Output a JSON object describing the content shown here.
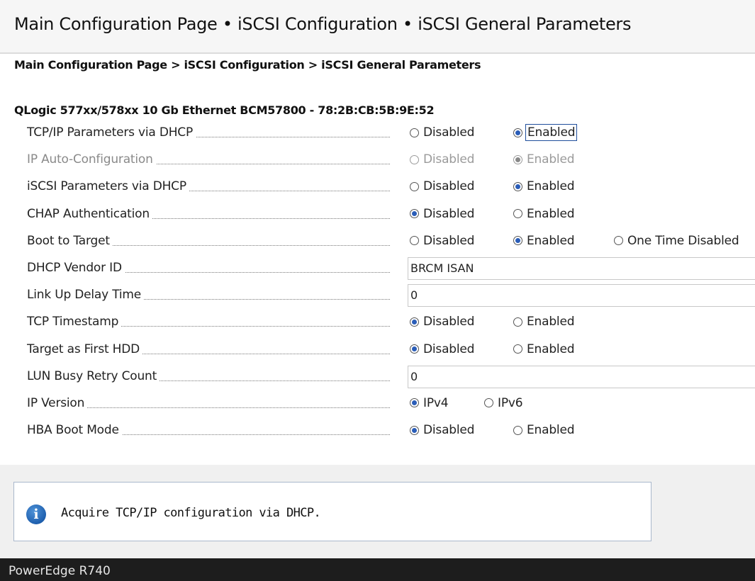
{
  "header": {
    "title": "Main Configuration Page • iSCSI Configuration • iSCSI General Parameters",
    "breadcrumb": "Main Configuration Page > iSCSI Configuration > iSCSI General Parameters",
    "device": "QLogic 577xx/578xx 10 Gb Ethernet BCM57800 - 78:2B:CB:5B:9E:52"
  },
  "settings": [
    {
      "label": "TCP/IP Parameters via DHCP",
      "options": [
        "Disabled",
        "Enabled"
      ],
      "selected": "Enabled",
      "focused": true
    },
    {
      "label": "IP Auto-Configuration",
      "options": [
        "Disabled",
        "Enabled"
      ],
      "selected": "Enabled",
      "disabled": true
    },
    {
      "label": "iSCSI Parameters via DHCP",
      "options": [
        "Disabled",
        "Enabled"
      ],
      "selected": "Enabled"
    },
    {
      "label": "CHAP Authentication",
      "options": [
        "Disabled",
        "Enabled"
      ],
      "selected": "Disabled"
    },
    {
      "label": "Boot to Target",
      "options": [
        "Disabled",
        "Enabled",
        "One Time Disabled"
      ],
      "selected": "Enabled"
    },
    {
      "label": "DHCP Vendor ID",
      "value": "BRCM ISAN"
    },
    {
      "label": "Link Up Delay Time",
      "value": "0"
    },
    {
      "label": "TCP Timestamp",
      "options": [
        "Disabled",
        "Enabled"
      ],
      "selected": "Disabled"
    },
    {
      "label": "Target as First HDD",
      "options": [
        "Disabled",
        "Enabled"
      ],
      "selected": "Disabled"
    },
    {
      "label": "LUN Busy Retry Count",
      "value": "0"
    },
    {
      "label": "IP Version",
      "options": [
        "IPv4",
        "IPv6"
      ],
      "selected": "IPv4"
    },
    {
      "label": "HBA Boot Mode",
      "options": [
        "Disabled",
        "Enabled"
      ],
      "selected": "Disabled"
    }
  ],
  "help": {
    "icon": "info-icon",
    "text": "Acquire TCP/IP configuration via DHCP."
  },
  "footer": {
    "system": "PowerEdge R740"
  },
  "colors": {
    "radio_selected": "#2a5db8",
    "focus_outline": "#1f4e9b",
    "footer_bg": "#1d1d1d"
  }
}
